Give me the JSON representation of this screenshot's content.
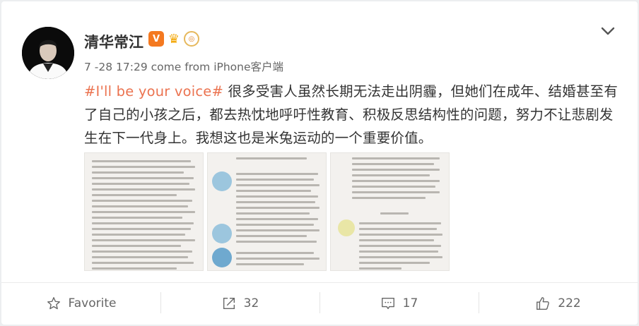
{
  "post": {
    "author": "清华常江",
    "timestamp": "7 -28 17:29 come from iPhone客户端",
    "hashtag": "#I'll be your voice#",
    "text": " 很多受害人虽然长期无法走出阴霾，但她们在成年、结婚甚至有了自己的小孩之后，都去热忱地呼吁性教育、积极反思结构性的问题，努力不让悲剧发生在下一代身上。我想这也是米兔运动的一个重要价值。",
    "badges": [
      "v-verified-icon",
      "crown-icon",
      "medal-icon"
    ]
  },
  "images": [
    {
      "name": "screenshot-image-1"
    },
    {
      "name": "screenshot-image-2"
    },
    {
      "name": "screenshot-image-3"
    }
  ],
  "actions": {
    "favorite_label": "Favorite",
    "repost_count": "32",
    "comment_count": "17",
    "like_count": "222"
  },
  "colors": {
    "hashtag": "#eb7350",
    "verified_badge": "#f47920",
    "background": "#eceef0"
  }
}
